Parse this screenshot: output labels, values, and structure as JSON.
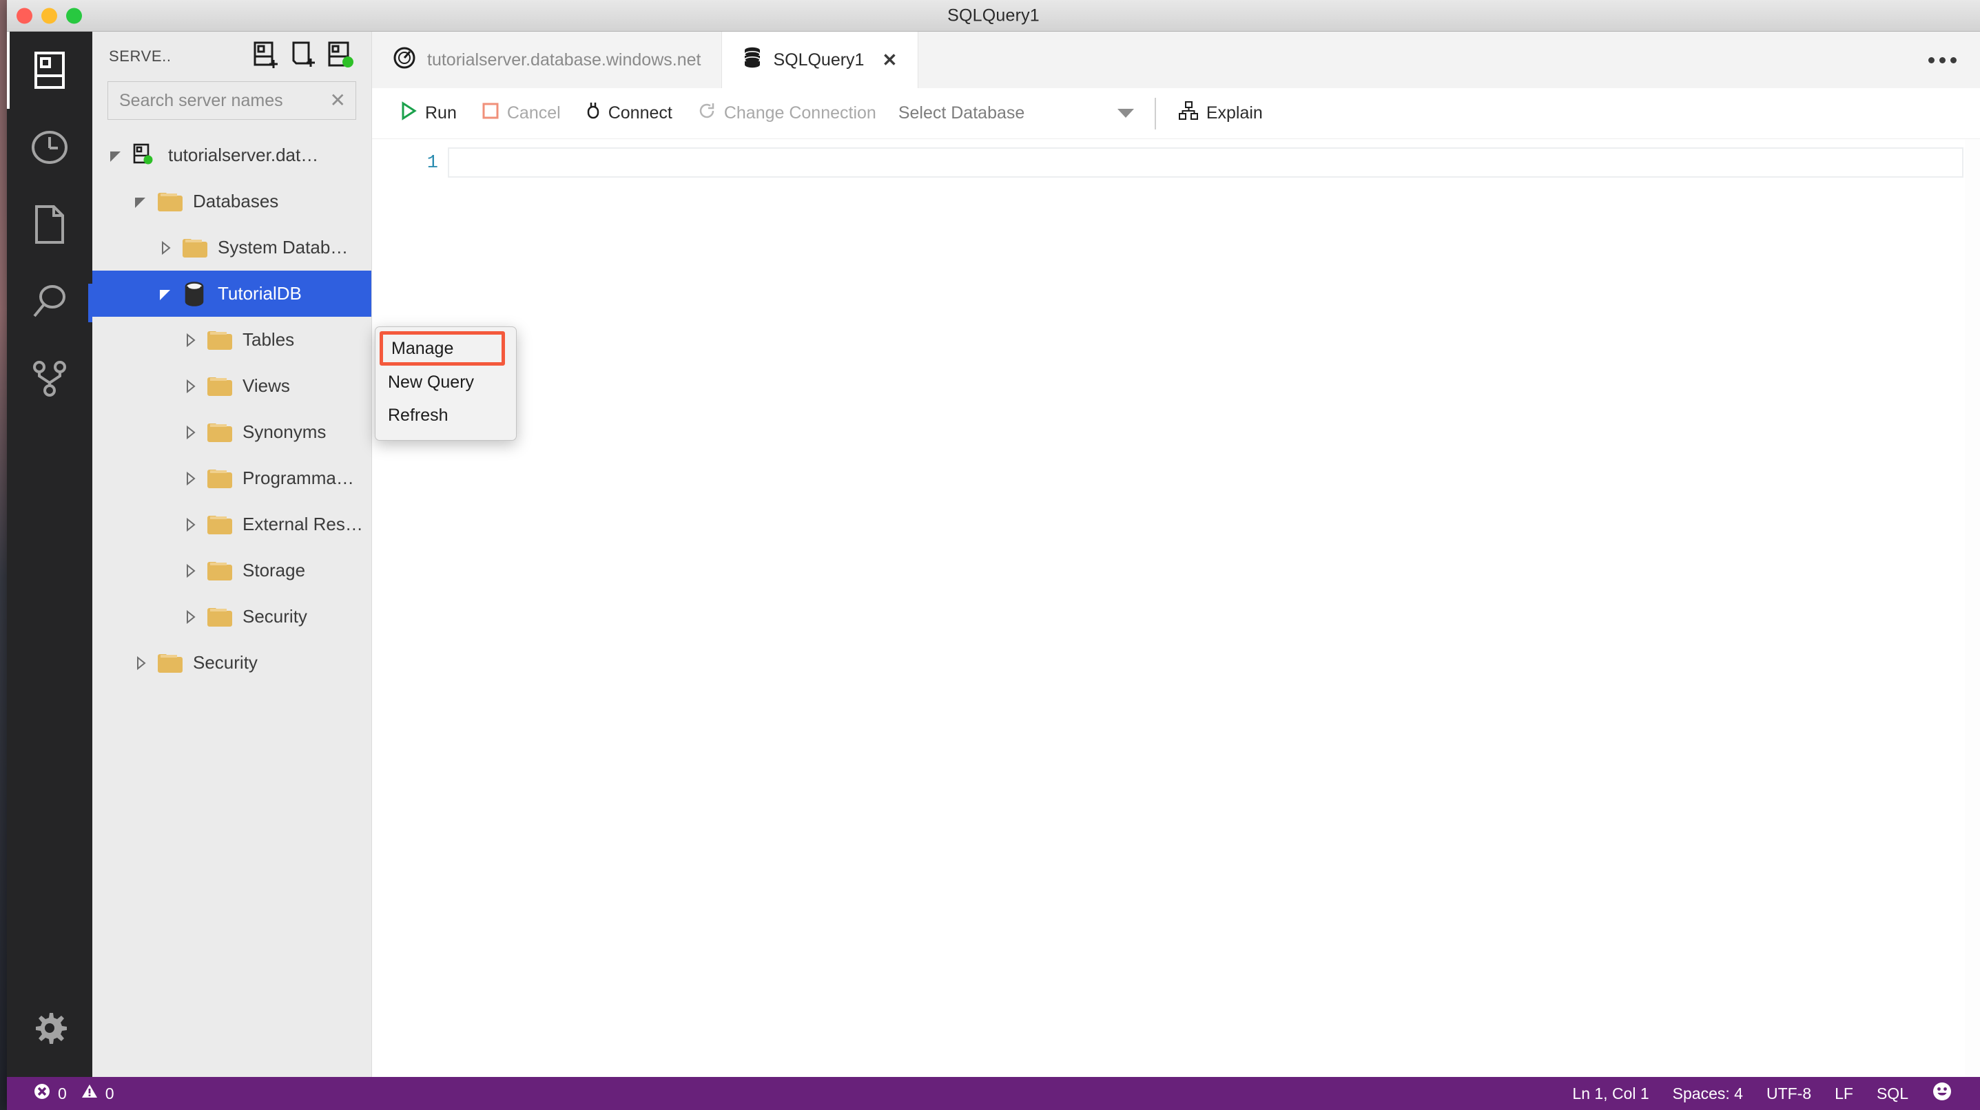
{
  "window": {
    "title": "SQLQuery1",
    "traffic_lights": [
      "close",
      "minimize",
      "zoom"
    ]
  },
  "activity_bar": {
    "items": [
      {
        "name": "servers",
        "icon": "server-icon",
        "active": true
      },
      {
        "name": "history",
        "icon": "clock-icon",
        "active": false
      },
      {
        "name": "file",
        "icon": "file-icon",
        "active": false
      },
      {
        "name": "search",
        "icon": "search-icon",
        "active": false
      },
      {
        "name": "source-control",
        "icon": "source-control-icon",
        "active": false
      }
    ],
    "bottom": {
      "name": "manage",
      "icon": "gear-icon"
    }
  },
  "sidebar": {
    "title": "SERVE..",
    "toolbar": [
      {
        "name": "add-connection",
        "icon": "add-server-icon"
      },
      {
        "name": "add-server-group",
        "icon": "add-server-group-icon"
      },
      {
        "name": "show-active-connections",
        "icon": "active-connections-icon"
      }
    ],
    "search": {
      "placeholder": "Search server names",
      "value": "",
      "clear_glyph": "✕"
    },
    "tree": [
      {
        "label": "tutorialserver.dat…",
        "icon": "server-icon",
        "indent": 0,
        "twisty": "expanded",
        "selected": false
      },
      {
        "label": "Databases",
        "icon": "folder-icon",
        "indent": 1,
        "twisty": "expanded",
        "selected": false
      },
      {
        "label": "System Datab…",
        "icon": "folder-icon",
        "indent": 2,
        "twisty": "collapsed",
        "selected": false
      },
      {
        "label": "TutorialDB",
        "icon": "database-icon",
        "indent": 2,
        "twisty": "expanded",
        "selected": true
      },
      {
        "label": "Tables",
        "icon": "folder-icon",
        "indent": 3,
        "twisty": "collapsed",
        "selected": false
      },
      {
        "label": "Views",
        "icon": "folder-icon",
        "indent": 3,
        "twisty": "collapsed",
        "selected": false
      },
      {
        "label": "Synonyms",
        "icon": "folder-icon",
        "indent": 3,
        "twisty": "collapsed",
        "selected": false
      },
      {
        "label": "Programma…",
        "icon": "folder-icon",
        "indent": 3,
        "twisty": "collapsed",
        "selected": false
      },
      {
        "label": "External Res…",
        "icon": "folder-icon",
        "indent": 3,
        "twisty": "collapsed",
        "selected": false
      },
      {
        "label": "Storage",
        "icon": "folder-icon",
        "indent": 3,
        "twisty": "collapsed",
        "selected": false
      },
      {
        "label": "Security",
        "icon": "folder-icon",
        "indent": 3,
        "twisty": "collapsed",
        "selected": false
      },
      {
        "label": "Security",
        "icon": "folder-icon",
        "indent": 1,
        "twisty": "collapsed",
        "selected": false
      }
    ]
  },
  "context_menu": {
    "items": [
      {
        "label": "Manage",
        "highlighted": true
      },
      {
        "label": "New Query",
        "highlighted": false
      },
      {
        "label": "Refresh",
        "highlighted": false
      }
    ],
    "highlight_color": "#f4593c"
  },
  "tabs": [
    {
      "label": "tutorialserver.database.windows.net",
      "icon": "dashboard-icon",
      "active": false,
      "closable": false
    },
    {
      "label": "SQLQuery1",
      "icon": "database-icon",
      "active": true,
      "closable": true,
      "close_glyph": "✕"
    }
  ],
  "tab_more": {
    "name": "more-actions",
    "glyph": "…"
  },
  "query_toolbar": {
    "run": {
      "label": "Run",
      "icon": "play-icon",
      "disabled": false
    },
    "cancel": {
      "label": "Cancel",
      "icon": "stop-icon",
      "disabled": true
    },
    "connect": {
      "label": "Connect",
      "icon": "plug-icon",
      "disabled": false
    },
    "change_connection": {
      "label": "Change Connection",
      "icon": "change-connection-icon",
      "disabled": true
    },
    "database_select": {
      "label": "Select Database",
      "value": ""
    },
    "explain": {
      "label": "Explain",
      "icon": "explain-plan-icon",
      "disabled": false
    }
  },
  "editor": {
    "line_numbers": [
      "1"
    ],
    "lines": [
      ""
    ],
    "cursor_line": 1
  },
  "status_bar": {
    "errors": {
      "icon": "error-icon",
      "count": "0"
    },
    "warnings": {
      "icon": "warning-icon",
      "count": "0"
    },
    "position": "Ln 1, Col 1",
    "spaces": "Spaces: 4",
    "encoding": "UTF-8",
    "eol": "LF",
    "language": "SQL",
    "feedback": {
      "icon": "smiley-icon",
      "glyph": "☺"
    },
    "background": "#68217a"
  },
  "colors": {
    "accent_blue": "#2f5fdf",
    "status_purple": "#68217a",
    "highlight_orange": "#f4593c",
    "folder_yellow": "#e5b95c",
    "connected_green": "#2ec027",
    "linenum_teal": "#2b8cb0"
  }
}
